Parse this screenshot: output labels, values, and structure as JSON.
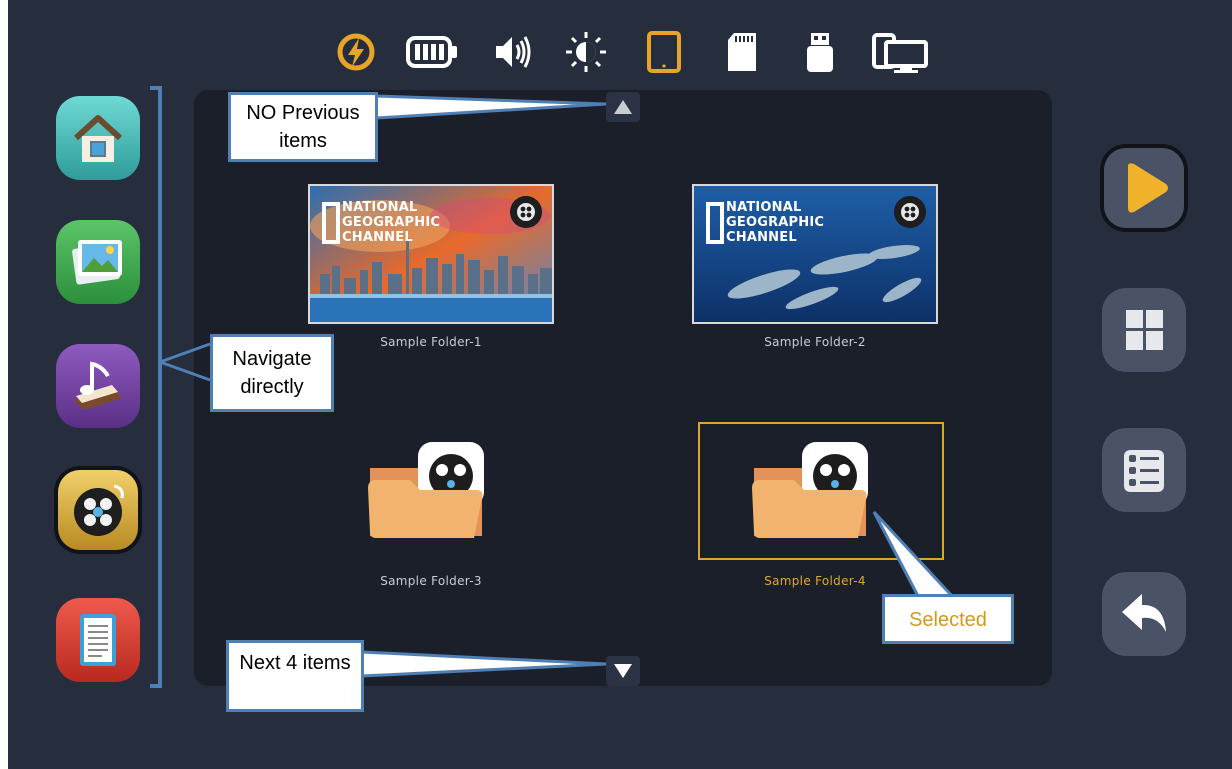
{
  "status_icons": [
    "charging-icon",
    "battery-icon",
    "volume-icon",
    "brightness-icon",
    "tablet-icon",
    "sd-card-icon",
    "usb-icon",
    "display-icon"
  ],
  "colors": {
    "background": "#262d3d",
    "panel": "#1b1f2a",
    "accent": "#e0a830",
    "callout_border": "#4f7fb4"
  },
  "sidebar": {
    "items": [
      {
        "name": "home",
        "icon": "home-icon"
      },
      {
        "name": "photos",
        "icon": "photos-icon"
      },
      {
        "name": "music",
        "icon": "music-icon"
      },
      {
        "name": "videos",
        "icon": "film-reel-icon",
        "active": true
      },
      {
        "name": "documents",
        "icon": "document-icon"
      }
    ]
  },
  "tiles": [
    {
      "label": "Sample Folder-1",
      "brand": "NATIONAL\nGEOGRAPHIC\nCHANNEL"
    },
    {
      "label": "Sample Folder-2",
      "brand": "NATIONAL\nGEOGRAPHIC\nCHANNEL"
    },
    {
      "label": "Sample Folder-3"
    },
    {
      "label": "Sample Folder-4",
      "selected": true
    }
  ],
  "right_panel": {
    "items": [
      {
        "name": "play",
        "icon": "play-icon",
        "active": true
      },
      {
        "name": "grid-view",
        "icon": "grid-icon"
      },
      {
        "name": "list-view",
        "icon": "list-icon"
      },
      {
        "name": "back",
        "icon": "back-arrow-icon"
      }
    ]
  },
  "callouts": {
    "no_previous": "NO Previous items",
    "navigate": "Navigate directly",
    "next": "Next 4 items",
    "selected": "Selected"
  }
}
